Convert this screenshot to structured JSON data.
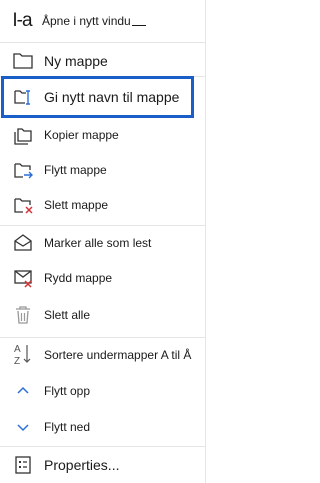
{
  "menu": {
    "items": [
      {
        "label": "Åpne i nytt vindu",
        "icon": "open-new-window-icon"
      },
      {
        "label": "Ny mappe",
        "icon": "new-folder-icon"
      },
      {
        "label": "Gi nytt navn til mappe",
        "icon": "rename-folder-icon"
      },
      {
        "label": "Kopier mappe",
        "icon": "copy-folder-icon"
      },
      {
        "label": "Flytt mappe",
        "icon": "move-folder-icon"
      },
      {
        "label": "Slett mappe",
        "icon": "delete-folder-icon"
      },
      {
        "label": "Marker alle som lest",
        "icon": "mark-all-read-icon"
      },
      {
        "label": "Rydd mappe",
        "icon": "clean-up-folder-icon"
      },
      {
        "label": "Slett alle",
        "icon": "delete-all-icon"
      },
      {
        "label": "Sortere undermapper A til Å",
        "icon": "sort-a-z-icon"
      },
      {
        "label": "Flytt opp",
        "icon": "chevron-up-icon"
      },
      {
        "label": "Flytt ned",
        "icon": "chevron-down-icon"
      },
      {
        "label": "Properties...",
        "icon": "properties-icon"
      }
    ],
    "highlight_color": "#1a5fc8",
    "accent_blue": "#2b6fd6",
    "delete_red": "#d13438"
  }
}
